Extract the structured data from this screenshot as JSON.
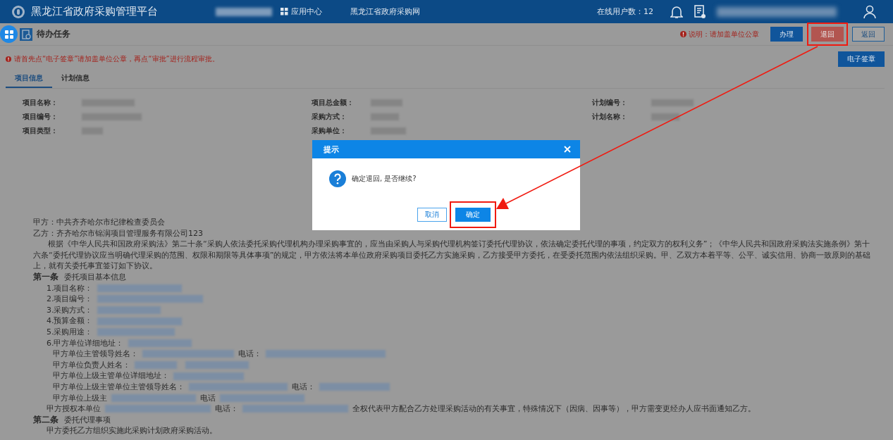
{
  "header": {
    "title": "黑龙江省政府采购管理平台",
    "app_center": "应用中心",
    "portal_link": "黑龙江省政府采购网",
    "online_users": "在线用户数：12"
  },
  "toolbar": {
    "title": "待办任务",
    "notice": "说明：请加盖单位公章",
    "buttons": [
      {
        "label": "办理",
        "kind": "primary",
        "highlighted": false
      },
      {
        "label": "退回",
        "kind": "danger",
        "highlighted": true
      },
      {
        "label": "返回",
        "kind": "outline",
        "highlighted": false
      }
    ]
  },
  "warning": "请首先点“电子签章”请加盖单位公章，再点“审批”进行流程审批。",
  "sign_button": "电子签章",
  "tabs": [
    {
      "label": "项目信息",
      "selected": true
    },
    {
      "label": "计划信息",
      "selected": false
    }
  ],
  "field_columns": [
    [
      "项目名称：",
      "项目编号：",
      "项目类型："
    ],
    [
      "项目总金额：",
      "采购方式：",
      "采购单位："
    ],
    [
      "计划编号：",
      "计划名称："
    ]
  ],
  "document": [
    {
      "kind": "plain",
      "parts": [
        {
          "kind": "text",
          "text": "甲方：中共齐齐哈尔市纪律检查委员会"
        }
      ]
    },
    {
      "kind": "plain",
      "parts": [
        {
          "kind": "text",
          "text": "乙方：齐齐哈尔市锦润项目管理服务有限公司123"
        }
      ]
    },
    {
      "kind": "paragraph",
      "parts": [
        {
          "kind": "text",
          "text": "根据《中华人民共和国政府采购法》第二十条“采购人依法委托采购代理机构办理采购事宜的，应当由采购人与采购代理机构签订委托代理协议，依法确定委托代理的事项，约定双方的权利义务”；《中华人民共和国政府采购法实施条例》第十六条“委托代理协议应当明确代理采购的范围、权限和期限等具体事项”的规定，甲方依法将本单位政府采购项目委托乙方实施采购，乙方接受甲方委托，在受委托范围内依法组织采购。甲、乙双方本着平等、公平、诚实信用、协商一致原则的基础上，就有关委托事宜签订如下协议。"
        }
      ]
    },
    {
      "kind": "heading",
      "parts": [
        {
          "kind": "title",
          "text": "第一条"
        },
        {
          "kind": "text",
          "text": "委托项目基本信息"
        }
      ]
    },
    {
      "kind": "item",
      "parts": [
        {
          "kind": "text",
          "text": "1.项目名称："
        },
        {
          "kind": "redacted"
        }
      ]
    },
    {
      "kind": "item",
      "parts": [
        {
          "kind": "text",
          "text": "2.项目编号："
        },
        {
          "kind": "redacted"
        }
      ]
    },
    {
      "kind": "item",
      "parts": [
        {
          "kind": "text",
          "text": "3.采购方式："
        },
        {
          "kind": "redacted"
        }
      ]
    },
    {
      "kind": "item",
      "parts": [
        {
          "kind": "text",
          "text": "4.预算金额："
        },
        {
          "kind": "redacted"
        }
      ]
    },
    {
      "kind": "item",
      "parts": [
        {
          "kind": "text",
          "text": "5.采购用途："
        },
        {
          "kind": "redacted"
        }
      ]
    },
    {
      "kind": "item",
      "parts": [
        {
          "kind": "text",
          "text": "6.甲方单位详细地址："
        },
        {
          "kind": "redacted"
        }
      ]
    },
    {
      "kind": "sub",
      "parts": [
        {
          "kind": "text",
          "text": "甲方单位主管领导姓名："
        },
        {
          "kind": "redacted"
        },
        {
          "kind": "text",
          "text": "电话："
        },
        {
          "kind": "redacted"
        }
      ]
    },
    {
      "kind": "sub",
      "parts": [
        {
          "kind": "text",
          "text": "甲方单位负责人姓名："
        },
        {
          "kind": "redacted"
        },
        {
          "kind": "redacted"
        }
      ]
    },
    {
      "kind": "sub",
      "parts": [
        {
          "kind": "text",
          "text": "甲方单位上级主管单位详细地址："
        },
        {
          "kind": "redacted"
        }
      ]
    },
    {
      "kind": "sub",
      "parts": [
        {
          "kind": "text",
          "text": "甲方单位上级主管单位主管领导姓名："
        },
        {
          "kind": "redacted"
        },
        {
          "kind": "text",
          "text": "电话："
        },
        {
          "kind": "redacted"
        }
      ]
    },
    {
      "kind": "sub",
      "parts": [
        {
          "kind": "text",
          "text": "甲方单位上级主"
        },
        {
          "kind": "redacted"
        },
        {
          "kind": "text",
          "text": "电话"
        },
        {
          "kind": "redacted"
        }
      ]
    },
    {
      "kind": "item",
      "parts": [
        {
          "kind": "text",
          "text": "甲方授权本单位"
        },
        {
          "kind": "redacted"
        },
        {
          "kind": "text",
          "text": "电话："
        },
        {
          "kind": "redacted"
        },
        {
          "kind": "text",
          "text": "全权代表甲方配合乙方处理采购活动的有关事宜，特殊情况下（因病、因事等），甲方需变更经办人应书面通知乙方。"
        }
      ]
    },
    {
      "kind": "heading",
      "parts": [
        {
          "kind": "title",
          "text": "第二条"
        },
        {
          "kind": "text",
          "text": "委托代理事项"
        }
      ]
    },
    {
      "kind": "item",
      "parts": [
        {
          "kind": "text",
          "text": "甲方委托乙方组织实施此采购计划政府采购活动。"
        }
      ]
    }
  ],
  "dialog": {
    "title": "提示",
    "message": "确定退回, 是否继续?",
    "buttons": [
      {
        "label": "取消",
        "kind": "outline",
        "highlighted": false
      },
      {
        "label": "确定",
        "kind": "primary",
        "highlighted": true
      }
    ]
  }
}
